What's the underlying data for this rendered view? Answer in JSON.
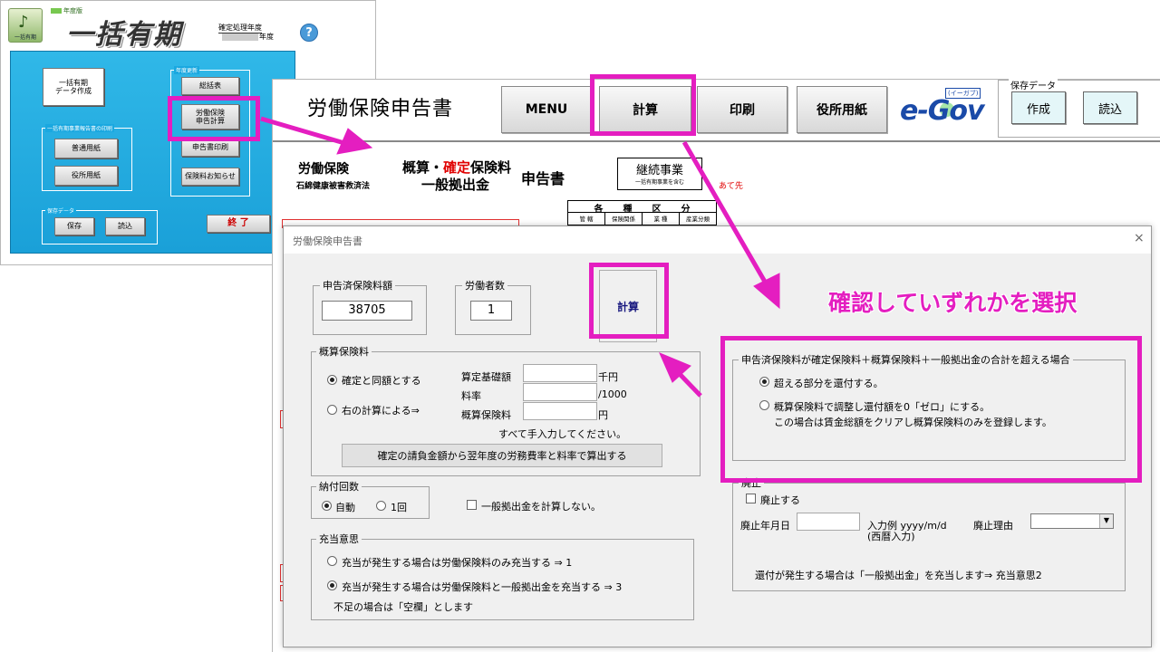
{
  "colors": {
    "highlight": "#e41ec0",
    "menu_panel": "#1aa8e0",
    "emphasis_red": "#e00000"
  },
  "main_menu": {
    "logo_caption": "一括有期",
    "year_badge": "年度版",
    "app_title": "一括有期",
    "fiscal_year_label": "確定処理年度",
    "fiscal_year_unit": "年度",
    "help_icon": "?",
    "data_create_button": "一括有期\nデータ作成",
    "print_group_label": "一括有期事業報告書の印刷",
    "standard_paper_button": "普通用紙",
    "office_paper_button": "役所用紙",
    "save_group_label": "保存データ",
    "save_button": "保存",
    "load_button": "読込",
    "update_group_label": "年度更新",
    "summary_button": "総括表",
    "labor_insurance_calc_button": "労働保険\n申告計算",
    "report_print_button": "申告書印刷",
    "notice_button": "保険料お知らせ",
    "end_button": "終 了"
  },
  "sheet": {
    "title": "労働保険申告書",
    "toolbar": {
      "menu": "MENU",
      "calculate": "計算",
      "print": "印刷",
      "office_paper": "役所用紙"
    },
    "egov": {
      "logo": "e-Gov",
      "reading": "(イーガブ)"
    },
    "save_data": {
      "label": "保存データ",
      "create": "作成",
      "load": "読込"
    },
    "form": {
      "head1": "労働保険",
      "head1_sub": "石綿健康被害救済法",
      "head2_prefix": "概算・",
      "head2_red": "確定",
      "head2_suffix": "保険料",
      "head3": "一般拠出金",
      "head4": "申告書",
      "keizoku_title": "継続事業",
      "keizoku_sub": "一括有期事業を含む",
      "atesaki": "あて先",
      "kubun_header": "各種区分",
      "kubun_columns": [
        "管 轄",
        "保険関係",
        "業 種",
        "産業分類"
      ]
    }
  },
  "dialog": {
    "title": "労働保険申告書",
    "close": "×",
    "declared_premium": {
      "label": "申告済保険料額",
      "value": "38705"
    },
    "workers": {
      "label": "労働者数",
      "value": "1"
    },
    "calc_button": "計算",
    "estimated_premium": {
      "label": "概算保険料",
      "option_same": "確定と同額とする",
      "option_calc": "右の計算による⇒",
      "base_label": "算定基礎額",
      "base_unit": "千円",
      "rate_label": "料率",
      "rate_unit": "/1000",
      "premium_label": "概算保険料",
      "premium_unit": "円",
      "manual_note": "すべて手入力してください。",
      "calc_from_contract_button": "確定の請負金額から翌年度の労務費率と料率で算出する"
    },
    "installments": {
      "label": "納付回数",
      "auto": "自動",
      "once": "1回"
    },
    "no_general_contribution": "一般拠出金を計算しない。",
    "appropriation": {
      "label": "充当意思",
      "option1": "充当が発生する場合は労働保険料のみ充当する ⇒ 1",
      "option3": "充当が発生する場合は労働保険料と一般拠出金を充当する ⇒ 3",
      "note": "不足の場合は「空欄」とします"
    },
    "excess": {
      "label": "申告済保険料が確定保険料＋概算保険料＋一般拠出金の合計を超える場合",
      "option_refund": "超える部分を還付する。",
      "option_zero": "概算保険料で調整し還付額を0「ゼロ」にする。",
      "option_zero_note": "この場合は賃金総額をクリアし概算保険料のみを登録します。"
    },
    "abolition": {
      "label": "廃止",
      "checkbox": "廃止する",
      "date_label": "廃止年月日",
      "date_example": "入力例 yyyy/m/d",
      "date_example_sub": "(西暦入力)",
      "reason_label": "廃止理由",
      "refund_note": "還付が発生する場合は「一般拠出金」を充当します⇒ 充当意思2"
    }
  },
  "annotation": "確認していずれかを選択"
}
